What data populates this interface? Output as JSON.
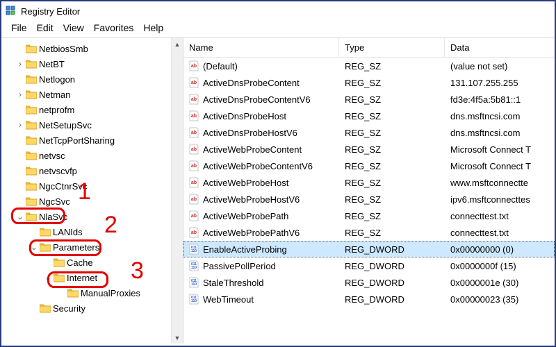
{
  "app": {
    "title": "Registry Editor"
  },
  "menu": {
    "file": "File",
    "edit": "Edit",
    "view": "View",
    "favorites": "Favorites",
    "help": "Help"
  },
  "tree": {
    "items": [
      {
        "indent": 1,
        "exp": "",
        "label": "NetbiosSmb"
      },
      {
        "indent": 1,
        "exp": ">",
        "label": "NetBT"
      },
      {
        "indent": 1,
        "exp": "",
        "label": "Netlogon"
      },
      {
        "indent": 1,
        "exp": ">",
        "label": "Netman"
      },
      {
        "indent": 1,
        "exp": "",
        "label": "netprofm"
      },
      {
        "indent": 1,
        "exp": ">",
        "label": "NetSetupSvc"
      },
      {
        "indent": 1,
        "exp": "",
        "label": "NetTcpPortSharing"
      },
      {
        "indent": 1,
        "exp": "",
        "label": "netvsc"
      },
      {
        "indent": 1,
        "exp": "",
        "label": "netvscvfp"
      },
      {
        "indent": 1,
        "exp": "",
        "label": "NgcCtnrSvc"
      },
      {
        "indent": 1,
        "exp": "",
        "label": "NgcSvc"
      },
      {
        "indent": 1,
        "exp": "v",
        "label": "NlaSvc"
      },
      {
        "indent": 2,
        "exp": "",
        "label": "LANIds"
      },
      {
        "indent": 2,
        "exp": "v",
        "label": "Parameters"
      },
      {
        "indent": 3,
        "exp": "",
        "label": "Cache"
      },
      {
        "indent": 3,
        "exp": "v",
        "label": "Internet"
      },
      {
        "indent": 4,
        "exp": "",
        "label": "ManualProxies"
      },
      {
        "indent": 2,
        "exp": "",
        "label": "Security"
      }
    ]
  },
  "columns": {
    "name": "Name",
    "type": "Type",
    "data": "Data"
  },
  "rows": [
    {
      "icon": "sz",
      "name": "(Default)",
      "type": "REG_SZ",
      "data": "(value not set)"
    },
    {
      "icon": "sz",
      "name": "ActiveDnsProbeContent",
      "type": "REG_SZ",
      "data": "131.107.255.255"
    },
    {
      "icon": "sz",
      "name": "ActiveDnsProbeContentV6",
      "type": "REG_SZ",
      "data": "fd3e:4f5a:5b81::1"
    },
    {
      "icon": "sz",
      "name": "ActiveDnsProbeHost",
      "type": "REG_SZ",
      "data": "dns.msftncsi.com"
    },
    {
      "icon": "sz",
      "name": "ActiveDnsProbeHostV6",
      "type": "REG_SZ",
      "data": "dns.msftncsi.com"
    },
    {
      "icon": "sz",
      "name": "ActiveWebProbeContent",
      "type": "REG_SZ",
      "data": "Microsoft Connect T"
    },
    {
      "icon": "sz",
      "name": "ActiveWebProbeContentV6",
      "type": "REG_SZ",
      "data": "Microsoft Connect T"
    },
    {
      "icon": "sz",
      "name": "ActiveWebProbeHost",
      "type": "REG_SZ",
      "data": "www.msftconnectte"
    },
    {
      "icon": "sz",
      "name": "ActiveWebProbeHostV6",
      "type": "REG_SZ",
      "data": "ipv6.msftconnecttes"
    },
    {
      "icon": "sz",
      "name": "ActiveWebProbePath",
      "type": "REG_SZ",
      "data": "connecttest.txt"
    },
    {
      "icon": "sz",
      "name": "ActiveWebProbePathV6",
      "type": "REG_SZ",
      "data": "connecttest.txt"
    },
    {
      "icon": "dw",
      "name": "EnableActiveProbing",
      "type": "REG_DWORD",
      "data": "0x00000000 (0)",
      "selected": true
    },
    {
      "icon": "dw",
      "name": "PassivePollPeriod",
      "type": "REG_DWORD",
      "data": "0x0000000f (15)"
    },
    {
      "icon": "dw",
      "name": "StaleThreshold",
      "type": "REG_DWORD",
      "data": "0x0000001e (30)"
    },
    {
      "icon": "dw",
      "name": "WebTimeout",
      "type": "REG_DWORD",
      "data": "0x00000023 (35)"
    }
  ],
  "annotations": [
    "1",
    "2",
    "3"
  ]
}
